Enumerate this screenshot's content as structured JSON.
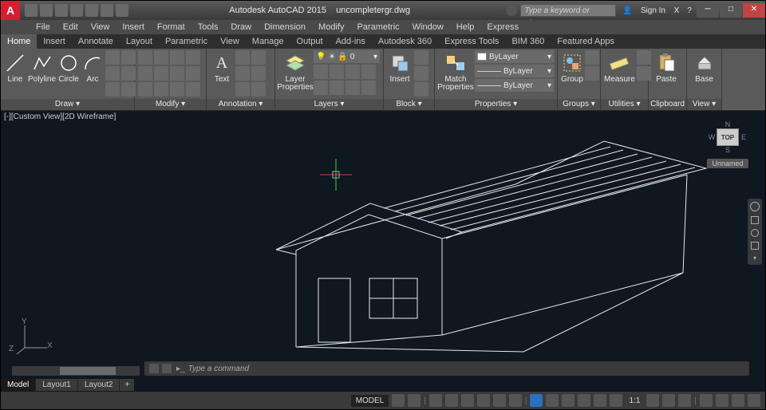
{
  "title": {
    "app": "Autodesk AutoCAD 2015",
    "file": "uncompletergr.dwg"
  },
  "search_placeholder": "Type a keyword or phrase",
  "signin": "Sign In",
  "menus": [
    "File",
    "Edit",
    "View",
    "Insert",
    "Format",
    "Tools",
    "Draw",
    "Dimension",
    "Modify",
    "Parametric",
    "Window",
    "Help",
    "Express"
  ],
  "ribbon_tabs": [
    "Home",
    "Insert",
    "Annotate",
    "Layout",
    "Parametric",
    "View",
    "Manage",
    "Output",
    "Add-ins",
    "Autodesk 360",
    "Express Tools",
    "BIM 360",
    "Featured Apps"
  ],
  "panels": {
    "draw": {
      "label": "Draw ▾",
      "line": "Line",
      "polyline": "Polyline",
      "circle": "Circle",
      "arc": "Arc"
    },
    "modify": {
      "label": "Modify ▾"
    },
    "annotation": {
      "label": "Annotation ▾",
      "text": "Text"
    },
    "layers": {
      "label": "Layers ▾",
      "props": "Layer\nProperties",
      "current": "0"
    },
    "block": {
      "label": "Block ▾",
      "insert": "Insert"
    },
    "properties": {
      "label": "Properties ▾",
      "match": "Match\nProperties",
      "layer": "ByLayer",
      "linew": "ByLayer",
      "ltype": "ByLayer"
    },
    "groups": {
      "label": "Groups ▾",
      "group": "Group"
    },
    "utilities": {
      "label": "Utilities ▾",
      "measure": "Measure"
    },
    "clipboard": {
      "label": "Clipboard",
      "paste": "Paste"
    },
    "view": {
      "label": "View ▾",
      "base": "Base"
    }
  },
  "view_label": "[-][Custom View][2D Wireframe]",
  "viewcube": {
    "top": "TOP",
    "n": "N",
    "e": "E",
    "s": "S",
    "w": "W",
    "label": "Unnamed"
  },
  "ucs": {
    "y": "Y",
    "z": "Z",
    "x": "X"
  },
  "command_placeholder": "Type a command",
  "layout_tabs": [
    "Model",
    "Layout1",
    "Layout2"
  ],
  "status": {
    "model": "MODEL",
    "scale": "1:1"
  }
}
